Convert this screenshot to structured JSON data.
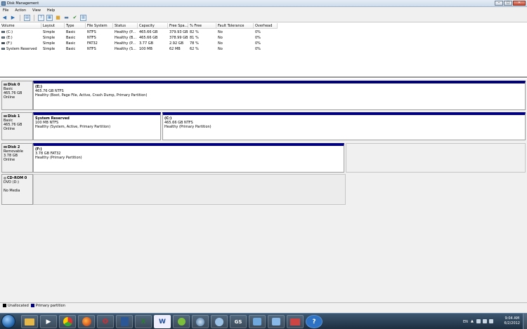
{
  "window": {
    "title": "Disk Management",
    "minimize": "–",
    "maximize": "□",
    "close": "✕"
  },
  "menu": [
    "File",
    "Action",
    "View",
    "Help"
  ],
  "toolbar_icons": [
    "back-arrow-icon",
    "forward-arrow-icon",
    "properties-icon",
    "help-icon",
    "refresh-icon",
    "folder-icon",
    "disk-icon",
    "check-icon",
    "options-icon"
  ],
  "volume_table": {
    "columns": [
      "Volume",
      "Layout",
      "Type",
      "File System",
      "Status",
      "Capacity",
      "Free Spa...",
      "% Free",
      "Fault Tolerance",
      "Overhead"
    ],
    "rows": [
      [
        "(C:)",
        "Simple",
        "Basic",
        "NTFS",
        "Healthy (P...",
        "465.66 GB",
        "379.93 GB",
        "82 %",
        "No",
        "0%"
      ],
      [
        "(E:)",
        "Simple",
        "Basic",
        "NTFS",
        "Healthy (B...",
        "465.66 GB",
        "378.99 GB",
        "81 %",
        "No",
        "0%"
      ],
      [
        "(F:)",
        "Simple",
        "Basic",
        "FAT32",
        "Healthy (P...",
        "3.77 GB",
        "2.92 GB",
        "78 %",
        "No",
        "0%"
      ],
      [
        "System Reserved",
        "Simple",
        "Basic",
        "NTFS",
        "Healthy (S...",
        "100 MB",
        "62 MB",
        "62 %",
        "No",
        "0%"
      ]
    ]
  },
  "disks": [
    {
      "name": "Disk 0",
      "type": "Basic",
      "size": "465.76 GB",
      "status": "Online",
      "partitions": [
        {
          "name": "(E:)",
          "detail": "465.76 GB NTFS",
          "status": "Healthy (Boot, Page File, Active, Crash Dump, Primary Partition)"
        }
      ]
    },
    {
      "name": "Disk 1",
      "type": "Basic",
      "size": "465.76 GB",
      "status": "Online",
      "partitions": [
        {
          "name": "System Reserved",
          "detail": "100 MB NTFS",
          "status": "Healthy (System, Active, Primary Partition)"
        },
        {
          "name": "(C:)",
          "detail": "465.66 GB NTFS",
          "status": "Healthy (Primary Partition)"
        }
      ]
    },
    {
      "name": "Disk 2",
      "type": "Removable",
      "size": "3.78 GB",
      "status": "Online",
      "partitions": [
        {
          "name": "(F:)",
          "detail": "3.78 GB FAT32",
          "status": "Healthy (Primary Partition)"
        }
      ]
    },
    {
      "name": "CD-ROM 0",
      "type": "DVD (D:)",
      "size": "",
      "status": "No Media",
      "partitions": []
    }
  ],
  "legend": [
    {
      "label": "Unallocated",
      "color": "#000000"
    },
    {
      "label": "Primary partition",
      "color": "#00007f"
    }
  ],
  "taskbar": {
    "apps": [
      "folder-icon",
      "media-player-icon",
      "chrome-icon",
      "firefox-icon",
      "opera-icon",
      "word-icon",
      "excel-icon",
      "word-icon",
      "grape-icon",
      "network-icon",
      "app-icon",
      "app-icon",
      "app-icon",
      "app-icon",
      "disk-management-icon",
      "help-icon"
    ],
    "app_glyphs": [
      "",
      "▶",
      "",
      "",
      "O",
      "",
      "X",
      "W",
      "",
      "",
      "",
      "GS",
      "",
      "",
      "",
      "?"
    ],
    "lang": "EN",
    "time": "9:04 AM",
    "date": "6/2/2012"
  }
}
